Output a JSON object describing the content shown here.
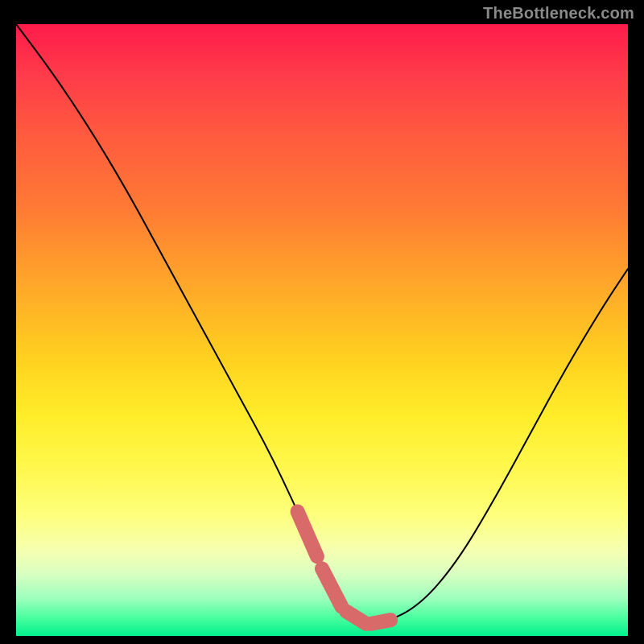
{
  "watermark": "TheBottleneck.com",
  "chart_data": {
    "type": "line",
    "title": "",
    "xlabel": "",
    "ylabel": "",
    "xlim": [
      0,
      100
    ],
    "ylim": [
      0,
      100
    ],
    "grid": false,
    "legend": false,
    "series": [
      {
        "name": "curve",
        "x": [
          0,
          6,
          12,
          18,
          24,
          30,
          36,
          42,
          48,
          52,
          56,
          60,
          66,
          72,
          78,
          84,
          90,
          96,
          100
        ],
        "values": [
          100,
          92,
          83,
          73,
          62,
          51,
          40,
          29,
          16,
          6,
          2,
          2,
          5,
          12,
          22,
          33,
          44,
          54,
          60
        ]
      }
    ],
    "highlight_range_x": [
      46,
      62
    ],
    "background_gradient": [
      "#ff1b4a",
      "#ff7a34",
      "#ffd21f",
      "#feff7a",
      "#00f08c"
    ]
  }
}
